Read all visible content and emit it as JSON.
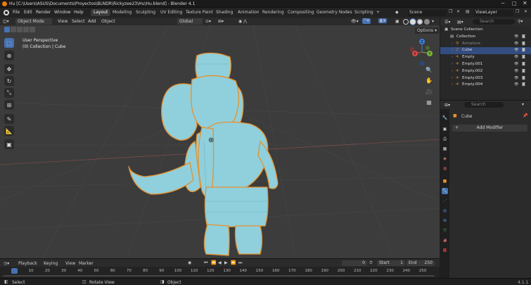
{
  "window": {
    "title": "Hu [C:\\Users\\ASUS\\Documents\\Proyectos\\BLNDR\\Rickyzee23\\Hu\\Hu.blend] - Blender 4.1"
  },
  "menu": [
    "File",
    "Edit",
    "Render",
    "Window",
    "Help"
  ],
  "workspaces": [
    "Layout",
    "Modeling",
    "Sculpting",
    "UV Editing",
    "Texture Paint",
    "Shading",
    "Animation",
    "Rendering",
    "Compositing",
    "Geometry Nodes",
    "Scripting"
  ],
  "active_workspace": "Layout",
  "add_tab": "+",
  "scene": {
    "name": "Scene"
  },
  "view_layer": {
    "name": "ViewLayer"
  },
  "viewport_header": {
    "mode": "Object Mode",
    "view": "View",
    "select": "Select",
    "add": "Add",
    "object": "Object",
    "orientation": "Global",
    "options": "Options"
  },
  "viewport": {
    "perspective": "User Perspective",
    "collection_info": "(0) Collection | Cube"
  },
  "gizmo": {
    "x": "X",
    "y": "Y",
    "z": "Z"
  },
  "outliner": {
    "search_placeholder": "Search",
    "items": [
      {
        "name": "Scene Collection",
        "depth": 0,
        "selected": false
      },
      {
        "name": "Collection",
        "depth": 1,
        "selected": false
      },
      {
        "name": "Armature",
        "depth": 2,
        "selected": false,
        "dim": true
      },
      {
        "name": "Cube",
        "depth": 2,
        "selected": true
      },
      {
        "name": "Empty",
        "depth": 2,
        "selected": false
      },
      {
        "name": "Empty.001",
        "depth": 2,
        "selected": false
      },
      {
        "name": "Empty.002",
        "depth": 2,
        "selected": false
      },
      {
        "name": "Empty.003",
        "depth": 2,
        "selected": false
      },
      {
        "name": "Empty.004",
        "depth": 2,
        "selected": false
      }
    ]
  },
  "properties": {
    "search_placeholder": "Search",
    "object_name": "Cube",
    "add_modifier": "Add Modifier"
  },
  "timeline": {
    "menus": [
      "Playback",
      "Keying",
      "View",
      "Marker"
    ],
    "current_frame": "0",
    "start_label": "Start",
    "start": "1",
    "end_label": "End",
    "end": "250",
    "ticks": [
      "0",
      "10",
      "20",
      "30",
      "40",
      "50",
      "60",
      "70",
      "80",
      "90",
      "100",
      "110",
      "120",
      "130",
      "140",
      "150",
      "160",
      "170",
      "180",
      "190",
      "200",
      "210",
      "220",
      "230",
      "240",
      "250"
    ]
  },
  "statusbar": {
    "select": "Select",
    "rotate": "Rotate View",
    "object": "Object",
    "version": "4.1.1"
  },
  "colors": {
    "accent": "#4772b3",
    "selection": "#334d80",
    "mesh": "#8fd0dc",
    "outline": "#e8902c"
  }
}
